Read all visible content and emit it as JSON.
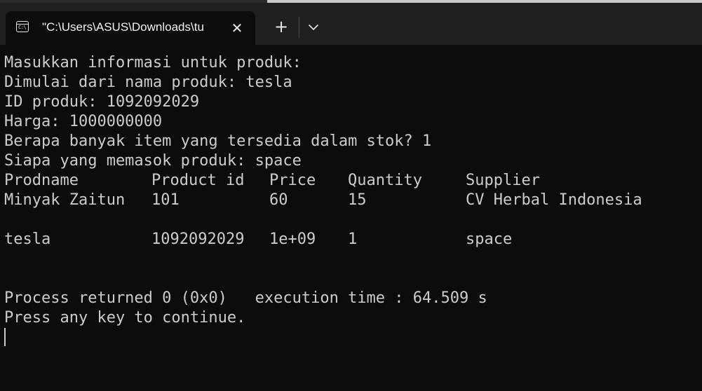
{
  "tab": {
    "title": "\"C:\\Users\\ASUS\\Downloads\\tu",
    "icon": "console-icon",
    "icon_text": "C:\\",
    "close_icon": "close-icon",
    "new_tab_icon": "plus-icon",
    "dropdown_icon": "chevron-down-icon"
  },
  "console": {
    "prompts": [
      "Masukkan informasi untuk produk:",
      "Dimulai dari nama produk: tesla",
      "ID produk: 1092092029",
      "Harga: 1000000000",
      "Berapa banyak item yang tersedia dalam stok? 1",
      "Siapa yang memasok produk: space"
    ],
    "table": {
      "headers": [
        "Prodname",
        "Product id",
        "Price",
        "Quantity",
        "Supplier"
      ],
      "rows": [
        [
          "Minyak Zaitun",
          "101",
          "60",
          "15",
          "CV Herbal Indonesia"
        ],
        [
          "tesla",
          "1092092029",
          "1e+09",
          "1",
          "space"
        ]
      ]
    },
    "process_line": "Process returned 0 (0x0)   execution time : 64.509 s",
    "continue_line": "Press any key to continue."
  },
  "colors": {
    "background": "#0c0c0c",
    "text": "#cccccc",
    "tabbar": "#202020"
  }
}
